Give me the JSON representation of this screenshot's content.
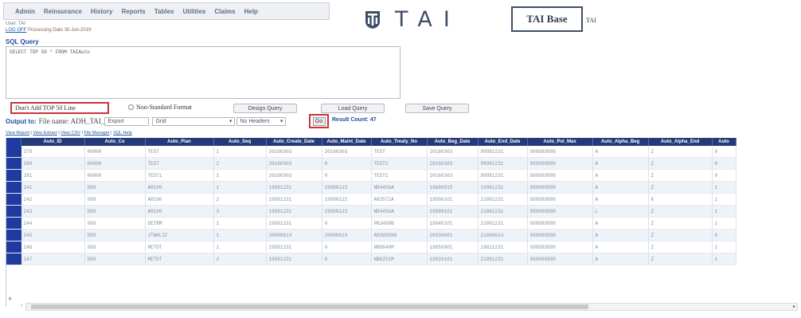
{
  "menu": [
    "Admin",
    "Reinsurance",
    "History",
    "Reports",
    "Tables",
    "Utilities",
    "Claims",
    "Help"
  ],
  "logo": {
    "text": "TAI",
    "icon": "tai-shield-icon"
  },
  "base": {
    "label": "TAI Base",
    "side": "TAI"
  },
  "user": {
    "line": "User: TAI"
  },
  "logoff": {
    "link": "LOG OFF",
    "processing": "Processing Date 30-Jun-2019"
  },
  "sql": {
    "label": "SQL Query",
    "text": "SELECT TOP 50 * FROM TAIAuto"
  },
  "options": {
    "top_n": "Don't Add TOP 50 Line",
    "non_standard": "Non-Standard Format"
  },
  "buttons": {
    "design": "Design Query",
    "load": "Load Query",
    "save": "Save Query",
    "go": "Go"
  },
  "output": {
    "label": "Output to:",
    "file_label": "File name: ADH_TAI_",
    "file_value": "Export",
    "format": "Grid",
    "headers": "No Headers",
    "result_count": "Result Count: 47"
  },
  "links": [
    "View Report",
    "View Extract",
    "View CSV",
    "File Manager",
    "SQL Help"
  ],
  "table": {
    "columns": [
      "Auto_ID",
      "Auto_Co",
      "Auto_Plan",
      "Auto_Seq",
      "Auto_Create_Date",
      "Auto_Maint_Date",
      "Auto_Treaty_No",
      "Auto_Beg_Date",
      "Auto_End_Date",
      "Auto_Pol_Max",
      "Auto_Alpha_Beg",
      "Auto_Alpha_End",
      "Auto"
    ],
    "rows": [
      [
        "279",
        "00000",
        "TEST",
        "1",
        "20160303",
        "20160303",
        "TEST",
        "20160303",
        "99991231",
        "999999999",
        "A",
        "Z",
        "0"
      ],
      [
        "280",
        "00000",
        "TEST",
        "2",
        "20160303",
        "0",
        "TEST1",
        "20160303",
        "99991231",
        "999999999",
        "A",
        "Z",
        "0"
      ],
      [
        "281",
        "00000",
        "TEST1",
        "1",
        "20160303",
        "0",
        "TEST1",
        "20160303",
        "99991231",
        "999999999",
        "A",
        "Z",
        "0"
      ],
      [
        "241",
        "999",
        "AR100",
        "1",
        "19991231",
        "19900122",
        "NR4456A",
        "19680815",
        "19981231",
        "999999999",
        "A",
        "Z",
        "1"
      ],
      [
        "242",
        "999",
        "AR100",
        "2",
        "19991231",
        "19900122",
        "AR3572A",
        "19990101",
        "21001231",
        "999999999",
        "A",
        "K",
        "1"
      ],
      [
        "243",
        "999",
        "AR100",
        "3",
        "19991231",
        "19900122",
        "NR4456A",
        "19990101",
        "21001231",
        "999999999",
        "L",
        "Z",
        "1"
      ],
      [
        "244",
        "999",
        "DETRM",
        "1",
        "19991231",
        "0",
        "PK3490B",
        "19940101",
        "21001231",
        "999999999",
        "A",
        "Z",
        "1"
      ],
      [
        "245",
        "999",
        "JTWHLIF",
        "1",
        "20000614",
        "20000614",
        "AR399998",
        "20030601",
        "21000614",
        "999999999",
        "A",
        "Z",
        "0"
      ],
      [
        "246",
        "999",
        "METDT",
        "1",
        "19991231",
        "0",
        "NR8840M",
        "19850901",
        "19811231",
        "999999999",
        "A",
        "Z",
        "1"
      ],
      [
        "247",
        "999",
        "METDT",
        "2",
        "19991231",
        "0",
        "NBK251M",
        "19920101",
        "21001231",
        "999999999",
        "A",
        "Z",
        "1"
      ]
    ]
  },
  "grid_footer": {
    "expand": "+"
  }
}
